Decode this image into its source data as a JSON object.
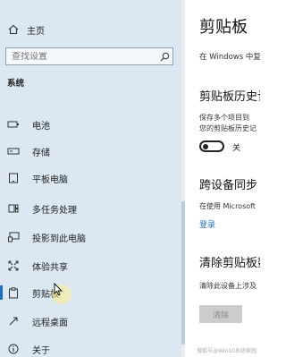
{
  "sidebar": {
    "home_label": "主页",
    "search_placeholder": "查找设置",
    "section_title": "系统",
    "items": [
      {
        "label": "电池"
      },
      {
        "label": "存储"
      },
      {
        "label": "平板电脑"
      },
      {
        "label": "多任务处理"
      },
      {
        "label": "投影到此电脑"
      },
      {
        "label": "体验共享"
      },
      {
        "label": "剪贴板",
        "active": true
      },
      {
        "label": "远程桌面"
      },
      {
        "label": "关于"
      }
    ]
  },
  "content": {
    "title": "剪贴板",
    "subtitle": "在 Windows 中复",
    "history": {
      "title": "剪贴板历史记",
      "desc_line1": "保存多个项目到",
      "desc_line2": "您的剪贴板历史记",
      "toggle_state": "关"
    },
    "sync": {
      "title": "跨设备同步",
      "desc": "在使用 Microsoft",
      "link": "登录"
    },
    "clear": {
      "title": "清除剪贴板数",
      "desc": "清除此设备上涉及",
      "button": "清除"
    }
  },
  "watermark": "搜狐号@Win10系统家园"
}
